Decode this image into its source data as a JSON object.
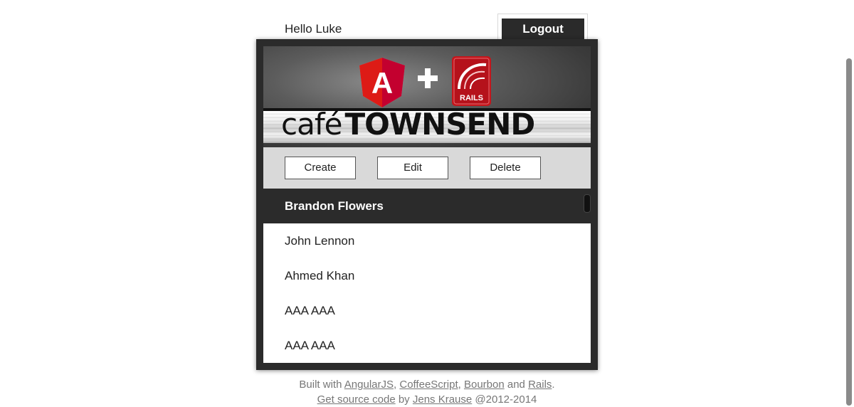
{
  "header": {
    "greeting": "Hello Luke",
    "logout_label": "Logout"
  },
  "banner": {
    "logos": [
      "angular-logo",
      "plus-icon",
      "rails-logo"
    ],
    "rails_text": "RAILS",
    "angular_text": "A",
    "cafe_text": "café",
    "townsend_text": "TOWNSEND"
  },
  "toolbar": {
    "create_label": "Create",
    "edit_label": "Edit",
    "delete_label": "Delete"
  },
  "employees": {
    "items": [
      {
        "name": "Brandon Flowers",
        "selected": true
      },
      {
        "name": "John Lennon",
        "selected": false
      },
      {
        "name": "Ahmed Khan",
        "selected": false
      },
      {
        "name": "AAA AAA",
        "selected": false
      },
      {
        "name": "AAA AAA",
        "selected": false
      }
    ]
  },
  "footer": {
    "built_with": "Built with",
    "angularjs": "AngularJS",
    "sep1": ",",
    "coffeescript": "CoffeeScript",
    "sep2": ",",
    "bourbon": "Bourbon",
    "and": "and",
    "rails": "Rails",
    "period": ".",
    "source_code": "Get source code",
    "by": "by",
    "author": "Jens Krause",
    "copyright": "@2012-2014"
  },
  "colors": {
    "dark": "#2b2b2b",
    "toolbar_bg": "#d9d9d9",
    "angular_red": "#dd1b16",
    "rails_red": "#c4161c",
    "footer_text": "#777777"
  }
}
